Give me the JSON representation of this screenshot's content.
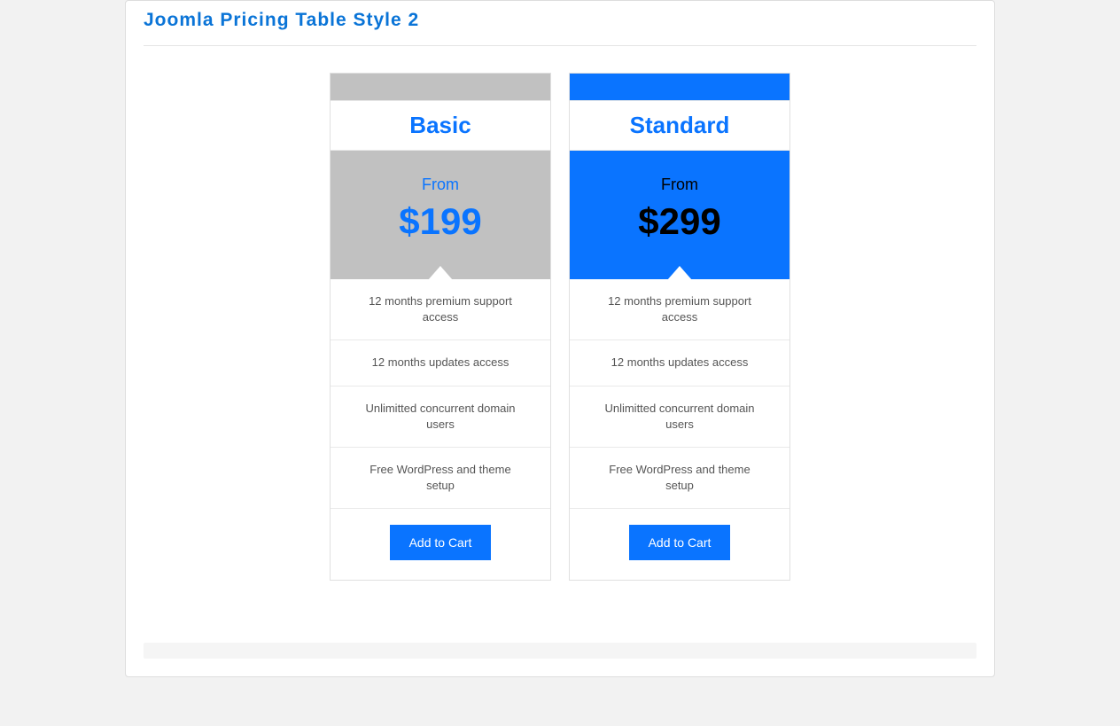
{
  "header": {
    "title": "Joomla Pricing Table Style 2"
  },
  "plans": [
    {
      "name": "Basic",
      "from_label": "From",
      "price": "$199",
      "features": [
        "12 months premium support access",
        "12 months updates access",
        "Unlimitted concurrent domain users",
        "Free WordPress and theme setup"
      ],
      "cta": "Add to Cart"
    },
    {
      "name": "Standard",
      "from_label": "From",
      "price": "$299",
      "features": [
        "12 months premium support access",
        "12 months updates access",
        "Unlimitted concurrent domain users",
        "Free WordPress and theme setup"
      ],
      "cta": "Add to Cart"
    }
  ]
}
